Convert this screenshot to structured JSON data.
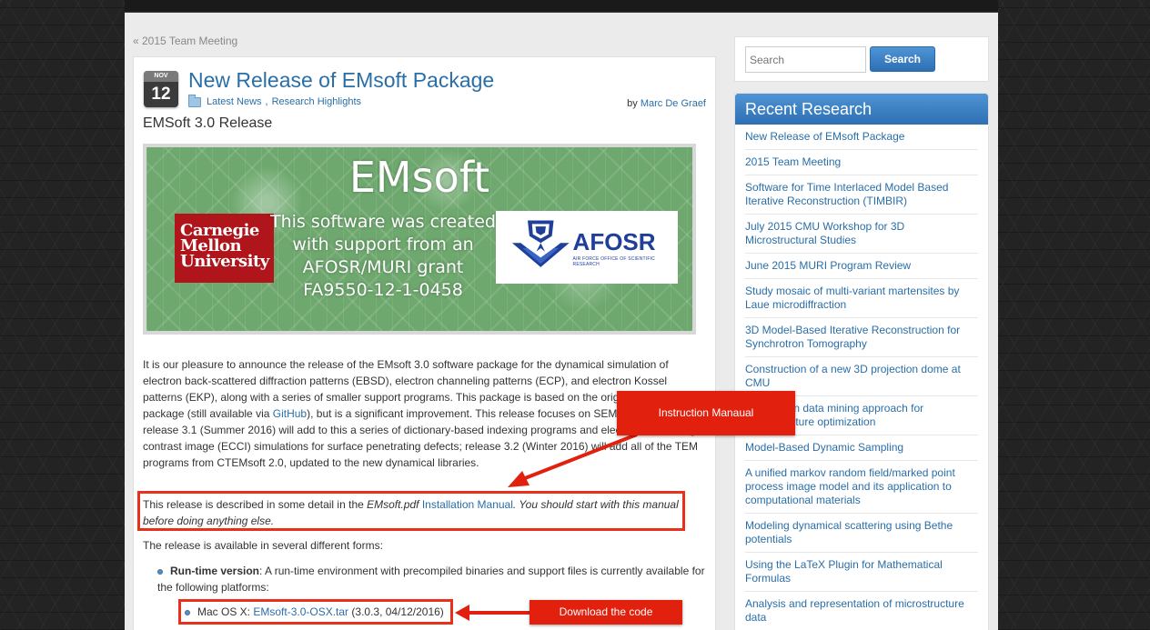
{
  "breadcrumb": {
    "prev_link": "« 2015 Team Meeting"
  },
  "post": {
    "date": {
      "month": "NOV",
      "day": "12"
    },
    "title": "New Release of EMsoft Package",
    "categories": [
      "Latest News",
      "Research Highlights"
    ],
    "category_separator": ",",
    "byline_prefix": "by",
    "author": "Marc De Graef",
    "subtitle": "EMSoft 3.0 Release",
    "banner": {
      "title": "EMsoft",
      "text": "This software was created with support from an AFOSR/MURI grant FA9550-12-1-0458",
      "cmu_logo": [
        "Carnegie",
        "Mellon",
        "University"
      ],
      "afosr_logo": "AFOSR",
      "afosr_sub": "AIR FORCE OFFICE OF SCIENTIFIC RESEARCH"
    },
    "paragraph1": {
      "part1": "It is our pleasure to announce the release of the EMsoft 3.0 software package for the dynamical simulation of electron back-scattered diffraction patterns (EBSD), electron channeling patterns (ECP), and electron Kossel patterns (EKP), along with a series of smaller support programs. This package is based on the original CTEMsoft 2.0 package (still available via ",
      "link": "GitHub",
      "part2": "), but is a significant improvement. This release focuses on SEM modalities; release 3.1 (Summer 2016) will add to this a series of dictionary-based indexing programs and electron channeling contrast image (ECCI) simulations for surface penetrating defects; release 3.2 (Winter 2016) will add all of the TEM programs from CTEMsoft 2.0, updated to the new dynamical libraries."
    },
    "paragraph2": {
      "part1": "This release is described in some detail in the ",
      "em1": "EMsoft.pdf",
      "link": "Installation Manual",
      "em2": ". You should start with this manual before doing anything else."
    },
    "availability": "The release is available in several different forms:",
    "runtime": {
      "label": "Run-time version",
      "text": ": A run-time environment with precompiled binaries and support files is currently available for the following platforms:"
    },
    "mac": {
      "prefix": "Mac OS X: ",
      "link": "EMsoft-3.0-OSX.tar",
      "suffix": " (3.0.3, 04/12/2016)"
    }
  },
  "callouts": {
    "instruction": "Instruction Manaual",
    "download": "Download the code"
  },
  "sidebar": {
    "search_placeholder": "Search",
    "search_button": "Search",
    "recent_title": "Recent Research",
    "recent_items": [
      "New Release of EMsoft Package",
      "2015 Team Meeting",
      "Software for Time Interlaced Model Based Iterative Reconstruction (TIMBIR)",
      "July 2015 CMU Workshop for 3D Microstructural Studies",
      "June 2015 MURI Program Review",
      "Study mosaic of multi-variant martensites by Laue microdiffraction",
      "3D Model-Based Iterative Reconstruction for Synchrotron Tomography",
      "Construction of a new 3D projection dome at CMU",
      "A Bayesian data mining approach for microstructure optimization",
      "Model-Based Dynamic Sampling",
      "A unified markov random field/marked point process image model and its application to computational materials",
      "Modeling dynamical scattering using Bethe potentials",
      "Using the LaTeX Plugin for Mathematical Formulas",
      "Analysis and representation of microstructure data"
    ]
  },
  "colors": {
    "link": "#2a6ea8",
    "highlight_red": "#e8301a",
    "callout_red": "#e2200e",
    "header_blue": "#2e6fb3"
  }
}
